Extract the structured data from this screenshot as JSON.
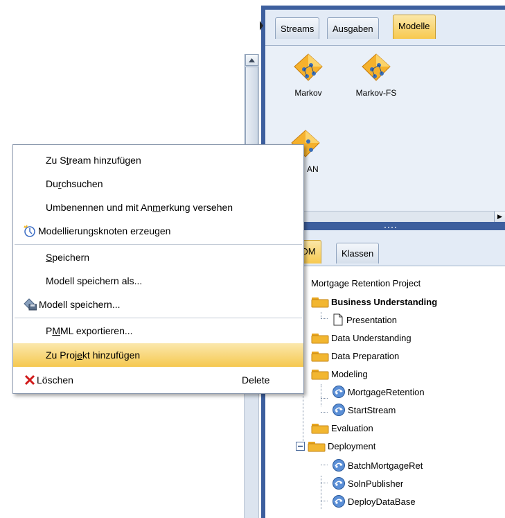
{
  "top_pane": {
    "tabs": [
      {
        "label": "Streams"
      },
      {
        "label": "Ausgaben"
      },
      {
        "label": "Modelle",
        "active": true
      }
    ],
    "models": [
      {
        "label": "Markov"
      },
      {
        "label": "Markov-FS"
      },
      {
        "label": "AN"
      }
    ]
  },
  "bottom_pane": {
    "tabs": [
      {
        "label": "-DM",
        "active": true
      },
      {
        "label": "Klassen"
      }
    ],
    "tree": {
      "root": "Mortgage Retention Project",
      "items": [
        {
          "label": "Business Understanding",
          "bold": true
        },
        {
          "label": "Presentation"
        },
        {
          "label": "Data Understanding"
        },
        {
          "label": "Data Preparation"
        },
        {
          "label": "Modeling"
        },
        {
          "label": "MortgageRetention"
        },
        {
          "label": "StartStream"
        },
        {
          "label": "Evaluation"
        },
        {
          "label": "Deployment",
          "expander": "⊟"
        },
        {
          "label": "BatchMortgageRet"
        },
        {
          "label": "SolnPublisher"
        },
        {
          "label": "DeployDataBase"
        }
      ]
    }
  },
  "context_menu": {
    "items": [
      {
        "label": "Zu Stream hinzufügen",
        "pre": "Zu S",
        "u": "t",
        "post": "ream hinzufügen"
      },
      {
        "label": "Durchsuchen",
        "pre": "Du",
        "u": "r",
        "post": "chsuchen"
      },
      {
        "label": "Umbenennen und mit Anmerkung versehen",
        "pre": "Umbenennen und mit An",
        "u": "m",
        "post": "erkung versehen"
      },
      {
        "label": "Modellierungsknoten erzeugen",
        "pre": "Modellierungsknoten erzeugen",
        "u": "",
        "post": ""
      },
      {
        "label": "Speichern",
        "pre": "",
        "u": "S",
        "post": "peichern"
      },
      {
        "label": "Modell speichern als...",
        "pre": "Modell speichern als...",
        "u": "",
        "post": ""
      },
      {
        "label": "Modell speichern...",
        "pre": "Modell speichern...",
        "u": "",
        "post": ""
      },
      {
        "label": "PMML exportieren...",
        "pre": "P",
        "u": "M",
        "post": "ML exportieren..."
      },
      {
        "label": "Zu Projekt hinzufügen",
        "pre": "Zu Proj",
        "u": "e",
        "post": "kt hinzufügen",
        "highlighted": true
      },
      {
        "label": "Löschen",
        "pre": "Löschen",
        "u": "",
        "post": "",
        "shortcut": "Delete"
      }
    ]
  },
  "colors": {
    "frame_blue": "#3d5f9e",
    "highlight": "#f5c84f",
    "folder": "#f2b630",
    "delete_red": "#d11a1a"
  },
  "icons": {
    "model": "model-diamond-icon",
    "generate": "model-generate-icon",
    "save": "model-save-icon",
    "delete": "delete-x-icon",
    "folder": "folder-icon",
    "document": "document-icon",
    "stream": "stream-node-icon"
  }
}
